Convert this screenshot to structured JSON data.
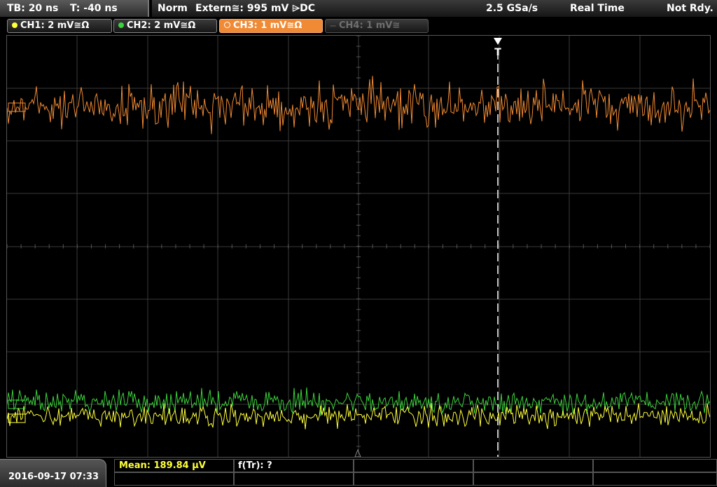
{
  "timebase": {
    "tb": "TB: 20 ns",
    "t": "T: -40 ns"
  },
  "status": {
    "mode": "Norm",
    "trigger_source": "Extern≅: 995 mV ⌲DC",
    "sample_rate": "2.5 GSa/s",
    "acquisition": "Real Time",
    "state": "Not Rdy."
  },
  "channels": [
    {
      "label": "CH1: 2 mV≅Ω",
      "color": "#ffff3c",
      "state": "on"
    },
    {
      "label": "CH2: 2 mV≅Ω",
      "color": "#3cd23c",
      "state": "on"
    },
    {
      "label": "CH3: 1 mV≅Ω",
      "color": "#f08a34",
      "state": "active"
    },
    {
      "label": "CH4: 1 mV≅",
      "color": "#6f6f6f",
      "state": "off"
    }
  ],
  "trigger_marker": "T",
  "datetime": "2016-09-17 07:33",
  "measurements": {
    "mean": "Mean: 189.84 µV",
    "freq": "f(Tr): ?"
  },
  "colors": {
    "ch1": "#ffff3c",
    "ch2": "#3cd23c",
    "ch3": "#f08a34",
    "grid": "#3a3a3a"
  }
}
